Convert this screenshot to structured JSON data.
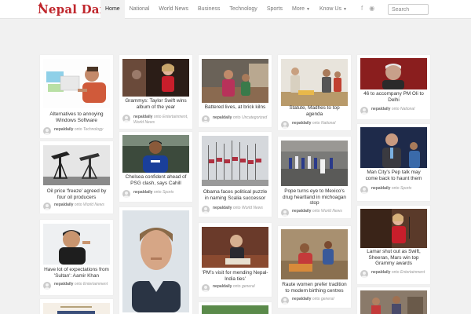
{
  "site": {
    "name": "Nepal Daily"
  },
  "nav": [
    {
      "label": "Home"
    },
    {
      "label": "National"
    },
    {
      "label": "World News"
    },
    {
      "label": "Business"
    },
    {
      "label": "Technology"
    },
    {
      "label": "Sports"
    },
    {
      "label": "More"
    },
    {
      "label": "Know Us"
    }
  ],
  "search": {
    "placeholder": "Search"
  },
  "cards": [
    {
      "title": "Alternatives to annoying Windows Software",
      "author": "nepaldaily",
      "onto": "onto",
      "category": "Technology"
    },
    {
      "title": "Oil price 'freeze' agreed by four oil producers",
      "author": "nepaldaily",
      "onto": "onto",
      "category": "World News"
    },
    {
      "title": "Have lot of expectations from 'Sultan': Aamir Khan",
      "author": "nepaldaily",
      "onto": "onto",
      "category": "Entertainment"
    },
    {
      "title": "Grammys: Taylor Swift wins album of the year",
      "author": "nepaldaily",
      "onto": "onto",
      "category": "Entertainment, World News"
    },
    {
      "title": "Chelsea confident ahead of PSG clash, says Cahill",
      "author": "nepaldaily",
      "onto": "onto",
      "category": "Sports"
    },
    {
      "title": "Battered lives, at brick kilns",
      "author": "nepaldaily",
      "onto": "onto",
      "category": "Uncategorized"
    },
    {
      "title": "Obama faces political puzzle in naming Scalia successor",
      "author": "nepaldaily",
      "onto": "onto",
      "category": "World News"
    },
    {
      "title": "'PM's visit for mending Nepal-India ties'",
      "author": "nepaldaily",
      "onto": "onto",
      "category": "general"
    },
    {
      "title": "Statute, Madhes to top agenda",
      "author": "nepaldaily",
      "onto": "onto",
      "category": "National"
    },
    {
      "title": "Pope turns eye to Mexico's drug heartland in michoagan stop",
      "author": "nepaldaily",
      "onto": "onto",
      "category": "World News"
    },
    {
      "title": "Raute women prefer tradition to modern birthing centres",
      "author": "nepaldaily",
      "onto": "onto",
      "category": "general"
    },
    {
      "title": "46 to accompany PM Oli to Delhi",
      "author": "nepaldaily",
      "onto": "onto",
      "category": "National"
    },
    {
      "title": "Man City's Pep talk may come back to haunt them",
      "author": "nepaldaily",
      "onto": "onto",
      "category": "Sports"
    },
    {
      "title": "Lamar shut out as Swift, Sheeran, Mars win top Grammy awards",
      "author": "nepaldaily",
      "onto": "onto",
      "category": "Entertainment"
    }
  ]
}
